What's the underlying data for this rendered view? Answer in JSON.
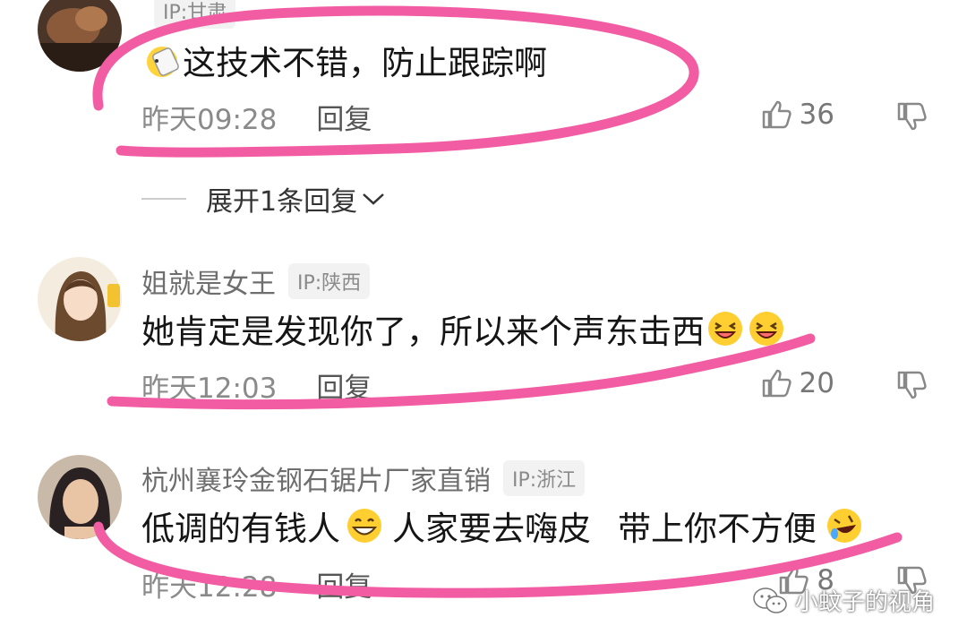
{
  "comments": [
    {
      "name": "",
      "ip": "IP:甘肃",
      "text": "这技术不错，防止跟踪啊",
      "time": "昨天09:28",
      "reply_label": "回复",
      "likes": "36"
    },
    {
      "name": "姐就是女王",
      "ip": "IP:陕西",
      "text": "她肯定是发现你了，所以来个声东击西",
      "time": "昨天12:03",
      "reply_label": "回复",
      "likes": "20"
    },
    {
      "name": "杭州襄玲金钢石锯片厂家直销",
      "ip": "IP:浙江",
      "text_part1": "低调的有钱人",
      "text_part2": "人家要去嗨皮",
      "text_part3": "带上你不方便",
      "time": "昨天12:28",
      "reply_label": "回复",
      "likes": "8"
    }
  ],
  "expand_replies": "展开1条回复",
  "watermark": "小蚊子的视角",
  "annotation_color": "#f25ca2"
}
